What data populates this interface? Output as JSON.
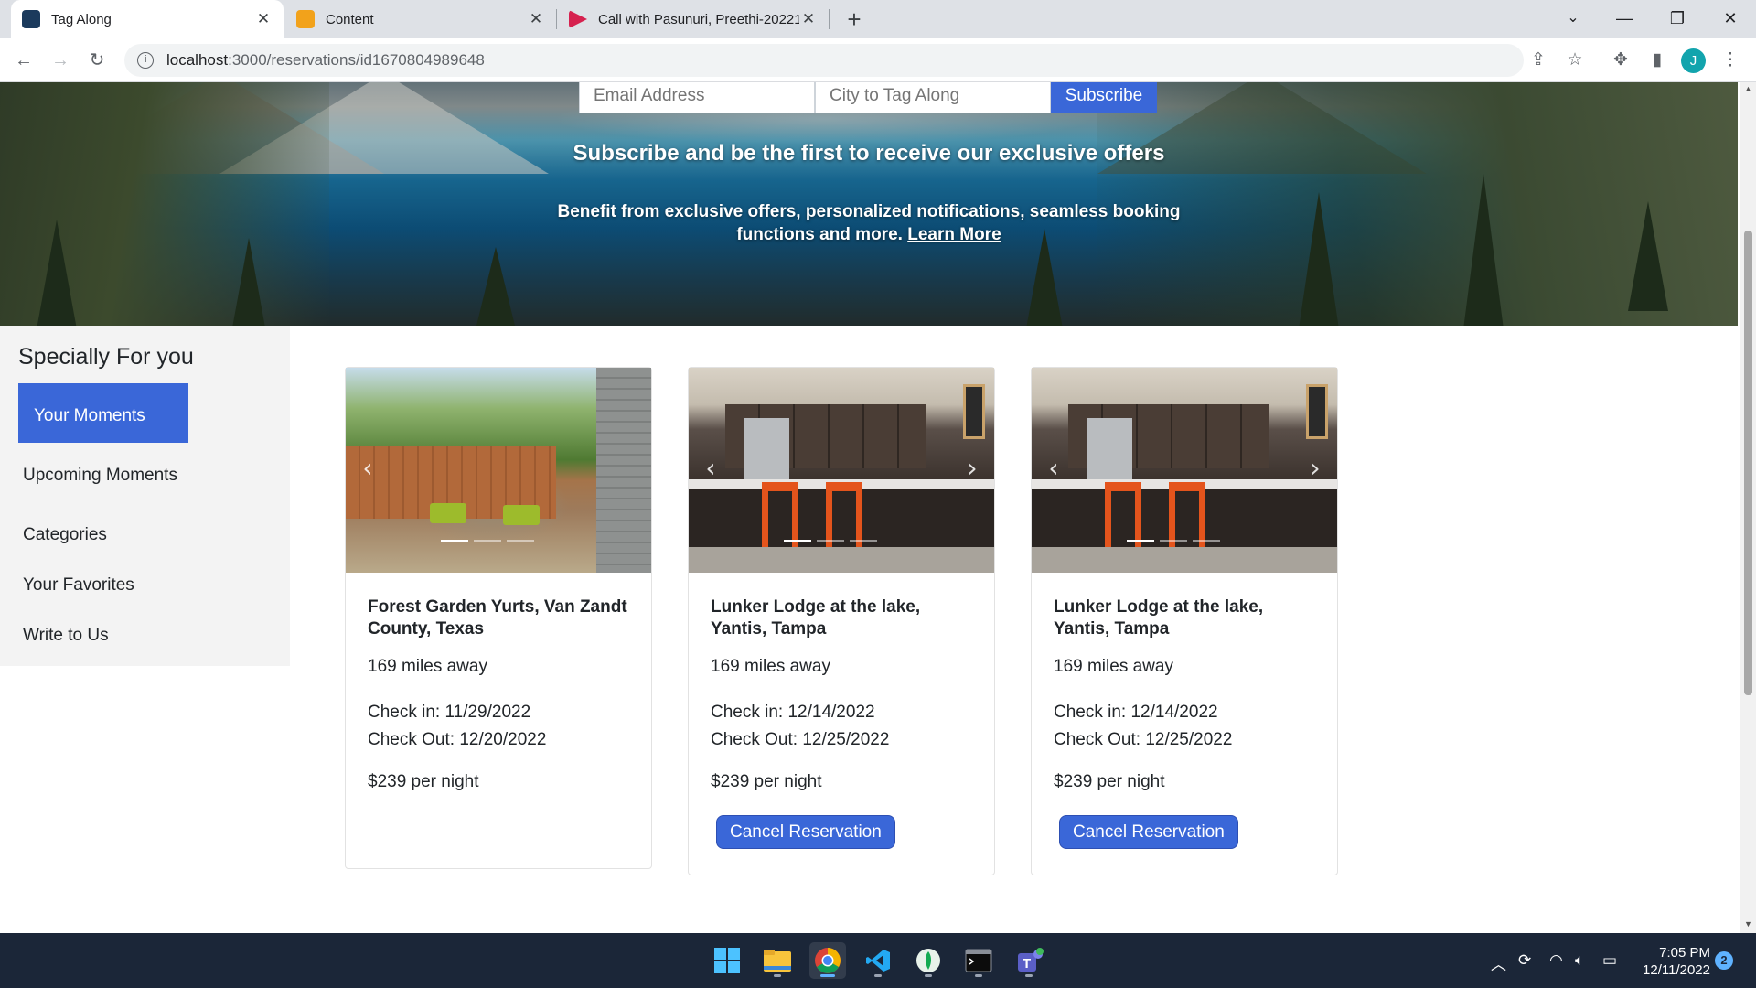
{
  "browser": {
    "tabs": [
      {
        "title": "Tag Along",
        "active": true,
        "favicon_color": "#1b3a5c"
      },
      {
        "title": "Content",
        "active": false,
        "favicon_color": "#f2a21b"
      },
      {
        "title": "Call with Pasunuri, Preethi-20221",
        "active": false,
        "favicon_color": "#d6214f"
      }
    ],
    "url_host": "localhost",
    "url_path": ":3000/reservations/id1670804989648",
    "avatar_initial": "J"
  },
  "subscribe": {
    "email_placeholder": "Email Address",
    "city_placeholder": "City to Tag Along",
    "button_label": "Subscribe",
    "title": "Subscribe and be the first to receive our exclusive offers",
    "text": "Benefit from exclusive offers, personalized notifications, seamless booking functions and more.",
    "link_label": "Learn More"
  },
  "sidebar": {
    "heading": "Specially For you",
    "active_item": "Your Moments",
    "items": [
      "Upcoming Moments",
      "Categories",
      "Your Favorites",
      "Write to Us"
    ]
  },
  "cards": [
    {
      "image": "garden-photo",
      "title": "Forest Garden Yurts, Van Zandt County, Texas",
      "distance": "169 miles away",
      "check_in": "Check in: 11/29/2022",
      "check_out": "Check Out: 12/20/2022",
      "price": "$239 per night",
      "button": null
    },
    {
      "image": "kitchen-photo",
      "title": "Lunker Lodge at the lake, Yantis, Tampa",
      "distance": "169 miles away",
      "check_in": "Check in: 12/14/2022",
      "check_out": "Check Out: 12/25/2022",
      "price": "$239 per night",
      "button": "Cancel Reservation"
    },
    {
      "image": "kitchen-photo",
      "title": "Lunker Lodge at the lake, Yantis, Tampa",
      "distance": "169 miles away",
      "check_in": "Check in: 12/14/2022",
      "check_out": "Check Out: 12/25/2022",
      "price": "$239 per night",
      "button": "Cancel Reservation"
    }
  ],
  "taskbar": {
    "apps": [
      "start-icon",
      "file-explorer-icon",
      "chrome-icon",
      "vscode-icon",
      "mongodb-compass-icon",
      "terminal-icon",
      "teams-icon"
    ],
    "time": "7:05 PM",
    "date": "12/11/2022",
    "notification_count": "2"
  },
  "colors": {
    "accent": "#3a67d8",
    "taskbar": "#1b2638",
    "sidebar_bg": "#f3f3f3"
  }
}
